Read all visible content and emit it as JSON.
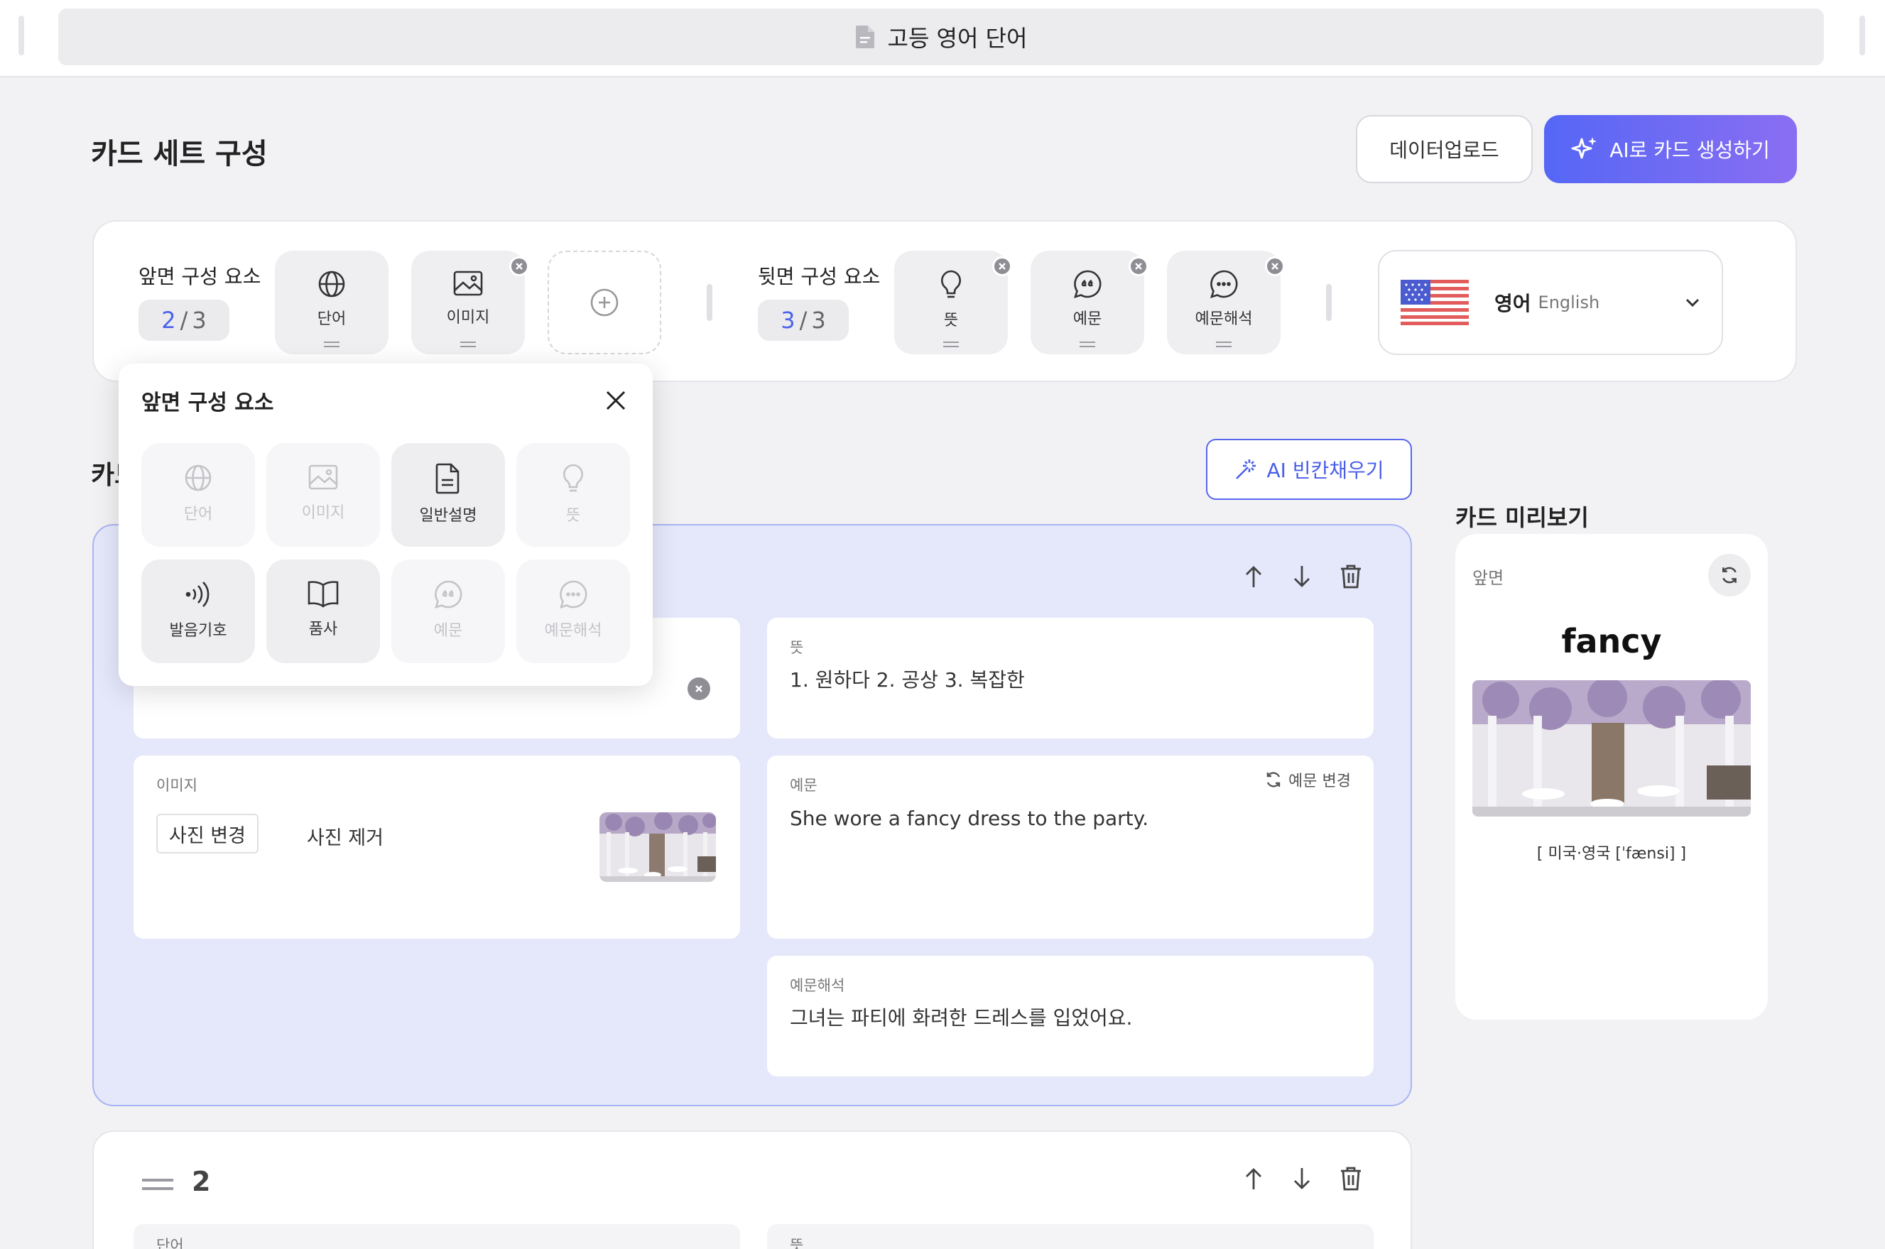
{
  "window": {
    "title": "고등 영어 단어"
  },
  "header": {
    "section_title": "카드 세트 구성",
    "upload_label": "데이터업로드",
    "ai_generate_label": "AI로 카드 생성하기"
  },
  "front": {
    "label": "앞면 구성 요소",
    "count_current": "2",
    "count_sep": "/",
    "count_max": "3",
    "items": [
      {
        "label": "단어",
        "icon": "globe-icon"
      },
      {
        "label": "이미지",
        "icon": "image-icon"
      }
    ]
  },
  "back": {
    "label": "뒷면 구성 요소",
    "count_current": "3",
    "count_sep": "/",
    "count_max": "3",
    "items": [
      {
        "label": "뜻",
        "icon": "lightbulb-icon"
      },
      {
        "label": "예문",
        "icon": "quote-icon"
      },
      {
        "label": "예문해석",
        "icon": "chat-icon"
      }
    ]
  },
  "language": {
    "name": "영어",
    "sub": "English"
  },
  "list": {
    "title": "카드 목록",
    "ai_fill_label": "AI 빈칸채우기"
  },
  "card1": {
    "meaning_label": "뜻",
    "meaning_value": "1. 원하다 2. 공상 3. 복잡한",
    "image_label": "이미지",
    "change_photo": "사진 변경",
    "remove_photo": "사진 제거",
    "example_label": "예문",
    "change_example": "예문 변경",
    "example_value": "She wore a fancy dress to the party.",
    "translation_label": "예문해석",
    "translation_value": "그녀는 파티에 화려한 드레스를 입었어요."
  },
  "card2": {
    "number": "2",
    "word_label": "단어",
    "meaning_label": "뜻"
  },
  "preview": {
    "title": "카드 미리보기",
    "side": "앞면",
    "word": "fancy",
    "pronunciation": "[ 미국·영국 [ˈfænsi] ]"
  },
  "popover": {
    "title": "앞면 구성 요소",
    "options": [
      {
        "label": "단어",
        "icon": "globe-icon",
        "enabled": false
      },
      {
        "label": "이미지",
        "icon": "image-icon",
        "enabled": false
      },
      {
        "label": "일반설명",
        "icon": "document-icon",
        "enabled": true
      },
      {
        "label": "뜻",
        "icon": "lightbulb-icon",
        "enabled": false
      },
      {
        "label": "발음기호",
        "icon": "sound-icon",
        "enabled": true
      },
      {
        "label": "품사",
        "icon": "book-icon",
        "enabled": true
      },
      {
        "label": "예문",
        "icon": "quote-icon",
        "enabled": false
      },
      {
        "label": "예문해석",
        "icon": "chat-icon",
        "enabled": false
      }
    ]
  },
  "colors": {
    "accent": "#4c63ec",
    "gradient_start": "#5567f5",
    "gradient_end": "#8a6ef2",
    "selected_card_bg": "#e5e8fb"
  }
}
